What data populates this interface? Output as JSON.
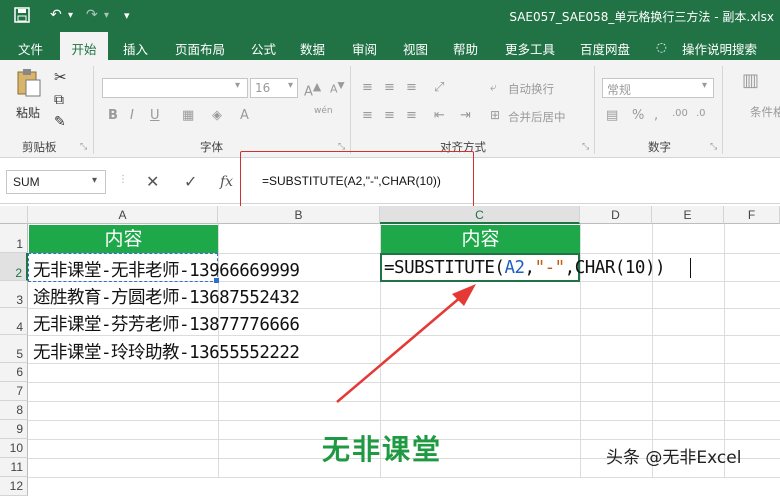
{
  "title_bar": {
    "doc_title": "SAE057_SAE058_单元格换行三方法 - 副本.xlsx"
  },
  "menu": [
    "文件",
    "开始",
    "插入",
    "页面布局",
    "公式",
    "数据",
    "审阅",
    "视图",
    "帮助",
    "更多工具",
    "百度网盘",
    "操作说明搜索"
  ],
  "ribbon": {
    "paste": "粘贴",
    "clipboard": "剪贴板",
    "font_size": "16",
    "font_group": "字体",
    "wrap_text": "自动换行",
    "merge_center": "合并后居中",
    "align_group": "对齐方式",
    "number_format": "常规",
    "number_group": "数字",
    "conditional": "条件格"
  },
  "formula_bar": {
    "name_box": "SUM",
    "fx": "fx",
    "formula": "=SUBSTITUTE(A2,\"-\",CHAR(10))"
  },
  "columns": [
    "A",
    "B",
    "C",
    "D",
    "E",
    "F"
  ],
  "rows": [
    "1",
    "2",
    "3",
    "4",
    "5",
    "6",
    "7",
    "8",
    "9",
    "10",
    "11",
    "12"
  ],
  "cells": {
    "a1": "内容",
    "c1": "内容",
    "a2": "无非课堂-无非老师-13966669999",
    "a3": "途胜教育-方圆老师-13687552432",
    "a4": "无非课堂-芬芳老师-13877776666",
    "a5": "无非课堂-玲玲助教-13655552222",
    "c2_prefix": "=SUBSTITUTE(",
    "c2_ref": "A2",
    "c2_sep1": ",",
    "c2_str": "\"-\"",
    "c2_suffix": ",CHAR(10))"
  },
  "watermark": "无非课堂",
  "credit": "头条 @无非Excel",
  "colors": {
    "excel_green": "#217346",
    "header_fill": "#1ea84a",
    "annotation_red": "#d32f2f",
    "ref_blue": "#1f5fbf",
    "str_orange": "#c55a11"
  }
}
